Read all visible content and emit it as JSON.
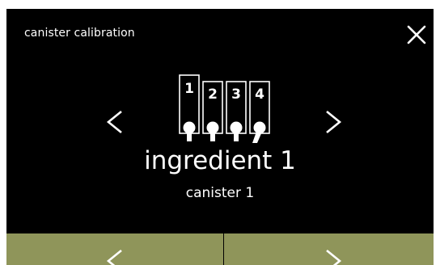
{
  "header": {
    "title": "canister calibration",
    "close_icon": "close-icon"
  },
  "selector": {
    "prev_icon": "chevron-left-icon",
    "next_icon": "chevron-right-icon",
    "canister_numbers": [
      "1",
      "2",
      "3",
      "4"
    ],
    "selected_index": 0,
    "ingredient_label": "ingredient 1",
    "canister_label": "canister 1"
  },
  "footer": {
    "prev_icon": "chevron-left-icon",
    "next_icon": "chevron-right-icon"
  },
  "colors": {
    "background": "#000000",
    "foreground": "#ffffff",
    "footer_button": "#8f955a"
  }
}
